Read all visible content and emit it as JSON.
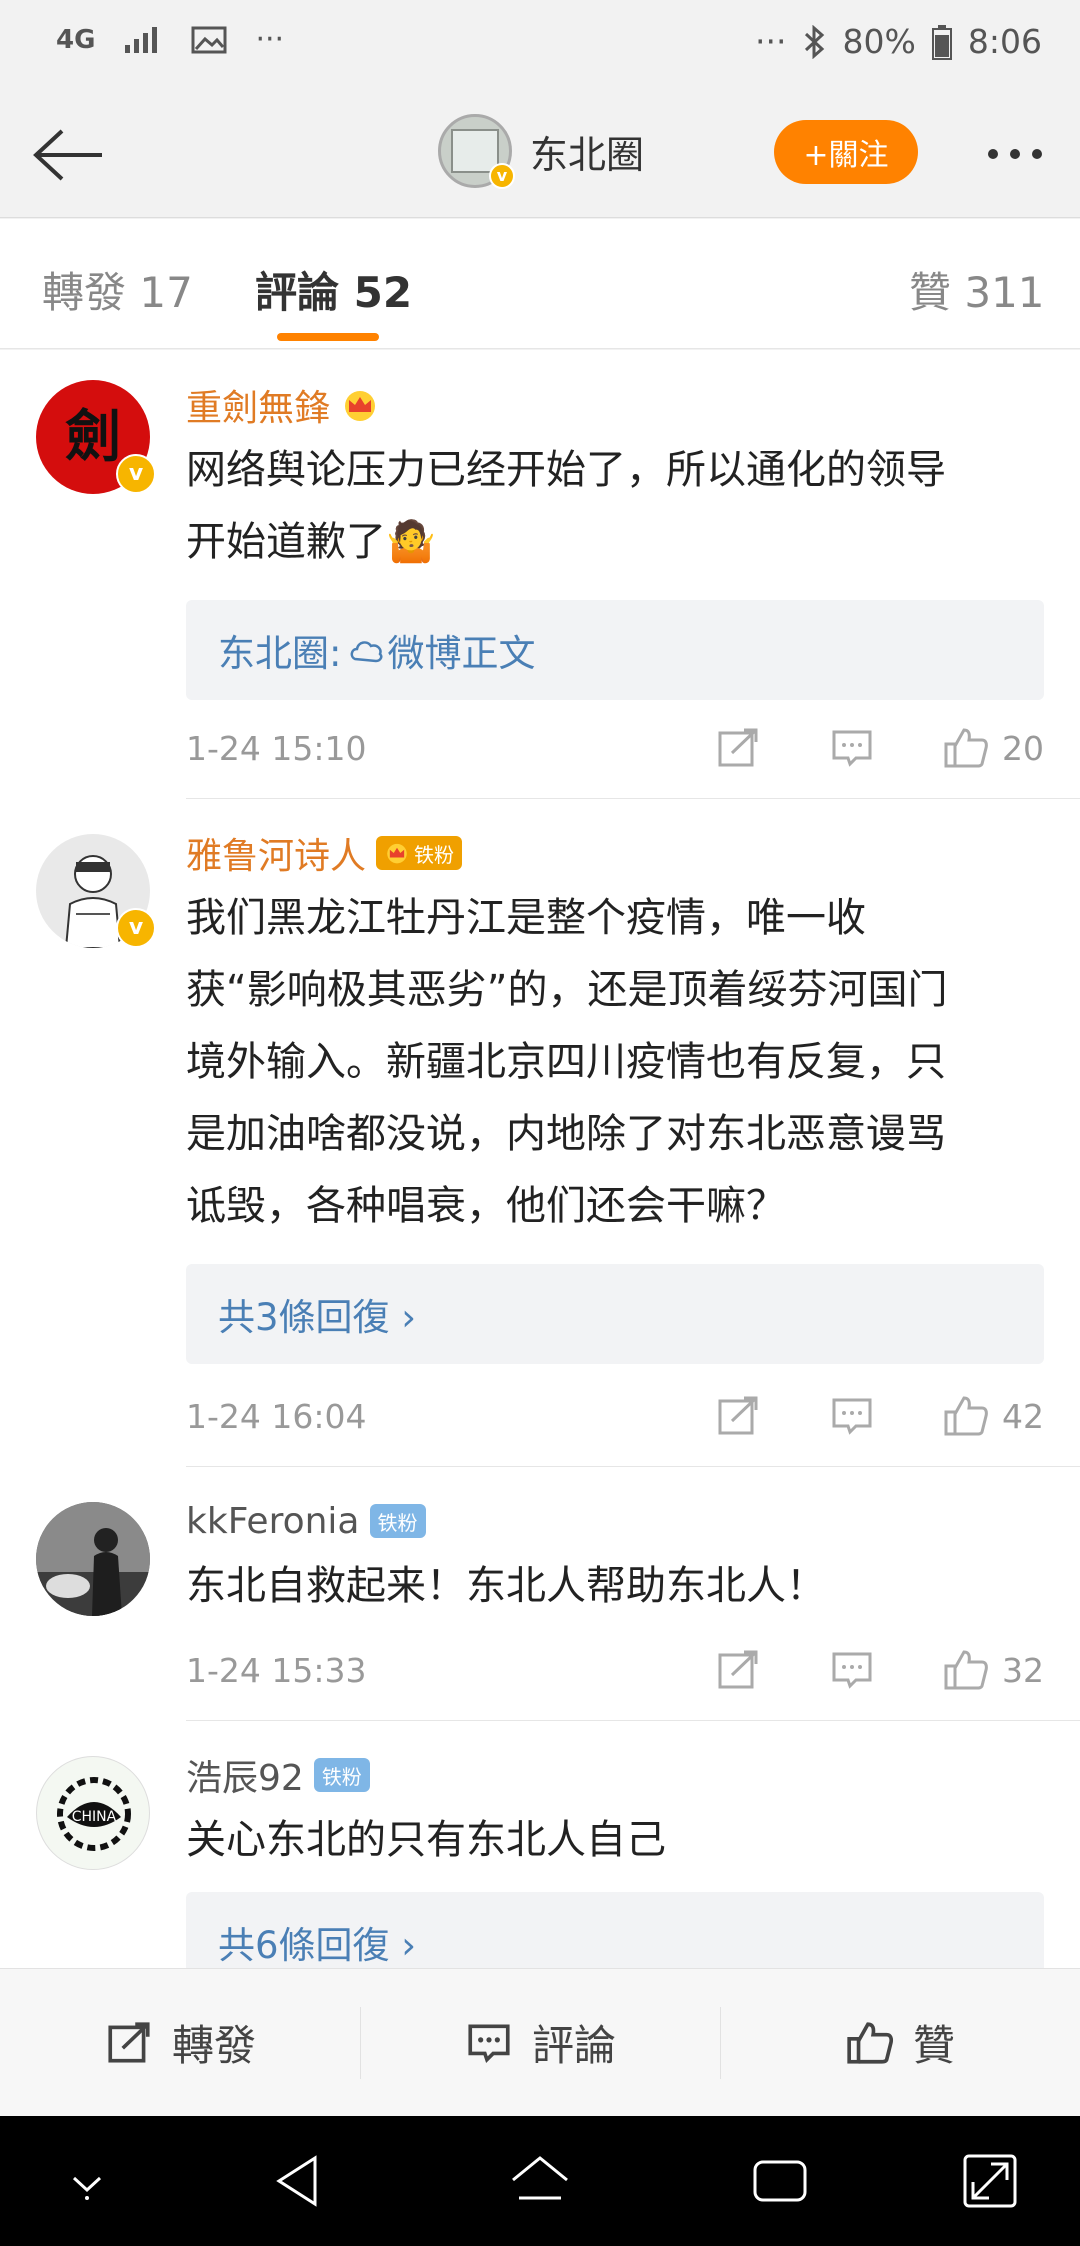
{
  "status": {
    "network": "4G",
    "battery": "80%",
    "time": "8:06",
    "left_more": "···",
    "right_more": "···"
  },
  "header": {
    "title": "东北圈",
    "follow_label": "+關注"
  },
  "tabs": [
    {
      "label": "轉發 17"
    },
    {
      "label": "評論 52"
    },
    {
      "label": "贊 311"
    }
  ],
  "comments": [
    {
      "name": "重劍無鋒",
      "text_lines": [
        "网络舆论压力已经开始了，所以通化的领导",
        "开始道歉了🤷"
      ],
      "reply_box": {
        "prefix": "东北圈:",
        "link": "微博正文"
      },
      "time": "1-24 15:10",
      "likes": "20"
    },
    {
      "name": "雅鲁河诗人",
      "badge": "铁粉",
      "text_lines": [
        "我们黑龙江牡丹江是整个疫情，唯一收",
        "获“影响极其恶劣”的，还是顶着绥芬河国门",
        "境外输入。新疆北京四川疫情也有反复，只",
        "是加油啥都没说，内地除了对东北恶意谩骂",
        "诋毁，各种唱衰，他们还会干嘛？"
      ],
      "reply_box": {
        "text": "共3條回復 ›"
      },
      "time": "1-24 16:04",
      "likes": "42"
    },
    {
      "name": "kkFeronia",
      "badge": "铁粉",
      "text_lines": [
        "东北自救起来！东北人帮助东北人！"
      ],
      "time": "1-24 15:33",
      "likes": "32"
    },
    {
      "name": "浩辰92",
      "badge": "铁粉",
      "text_lines": [
        "关心东北的只有东北人自己"
      ],
      "reply_box": {
        "text": "共6條回復 ›"
      }
    }
  ],
  "bottom_bar": {
    "repost": "轉發",
    "comment": "評論",
    "like": "贊"
  },
  "colors": {
    "accent": "#ff8200",
    "name_orange": "#e07b24",
    "link_blue": "#4a7fb5"
  }
}
